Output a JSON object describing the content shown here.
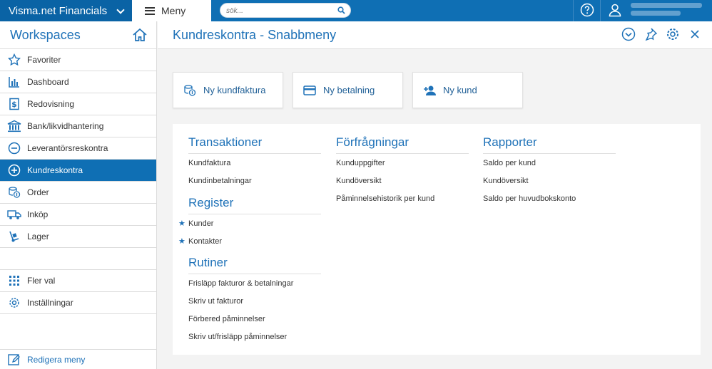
{
  "topbar": {
    "brand": "Visma.net Financials",
    "menu_label": "Meny",
    "search_placeholder": "sök..."
  },
  "sidebar": {
    "title": "Workspaces",
    "items": [
      {
        "label": "Favoriter",
        "icon": "star-icon"
      },
      {
        "label": "Dashboard",
        "icon": "bar-chart-icon"
      },
      {
        "label": "Redovisning",
        "icon": "ledger-dollar-icon"
      },
      {
        "label": "Bank/likvidhantering",
        "icon": "bank-icon"
      },
      {
        "label": "Leverantörsreskontra",
        "icon": "minus-circle-icon"
      },
      {
        "label": "Kundreskontra",
        "icon": "plus-circle-icon",
        "active": true
      },
      {
        "label": "Order",
        "icon": "order-coins-icon"
      },
      {
        "label": "Inköp",
        "icon": "truck-icon"
      },
      {
        "label": "Lager",
        "icon": "hand-truck-icon"
      }
    ],
    "bottom_items": [
      {
        "label": "Fler val",
        "icon": "grid-icon"
      },
      {
        "label": "Inställningar",
        "icon": "gear-icon"
      }
    ],
    "edit_menu": "Redigera meny"
  },
  "main": {
    "title": "Kundreskontra - Snabbmeny",
    "quick_actions": [
      {
        "label": "Ny kundfaktura",
        "icon": "invoice-coins-icon"
      },
      {
        "label": "Ny betalning",
        "icon": "credit-card-icon"
      },
      {
        "label": "Ny kund",
        "icon": "add-user-icon"
      }
    ],
    "sections": {
      "transaktioner": {
        "title": "Transaktioner",
        "links": [
          "Kundfaktura",
          "Kundinbetalningar"
        ]
      },
      "register": {
        "title": "Register",
        "links": [
          "Kunder",
          "Kontakter"
        ]
      },
      "rutiner": {
        "title": "Rutiner",
        "links": [
          "Frisläpp fakturor & betalningar",
          "Skriv ut fakturor",
          "Förbered påminnelser",
          "Skriv ut/frisläpp påminnelser"
        ]
      },
      "forfragningar": {
        "title": "Förfrågningar",
        "links": [
          "Kunduppgifter",
          "Kundöversikt",
          "Påminnelsehistorik per kund"
        ]
      },
      "rapporter": {
        "title": "Rapporter",
        "links": [
          "Saldo per kund",
          "Kundöversikt",
          "Saldo per huvudbokskonto"
        ]
      }
    }
  },
  "colors": {
    "accent": "#0f6fb4",
    "link_blue": "#1f72b8"
  }
}
